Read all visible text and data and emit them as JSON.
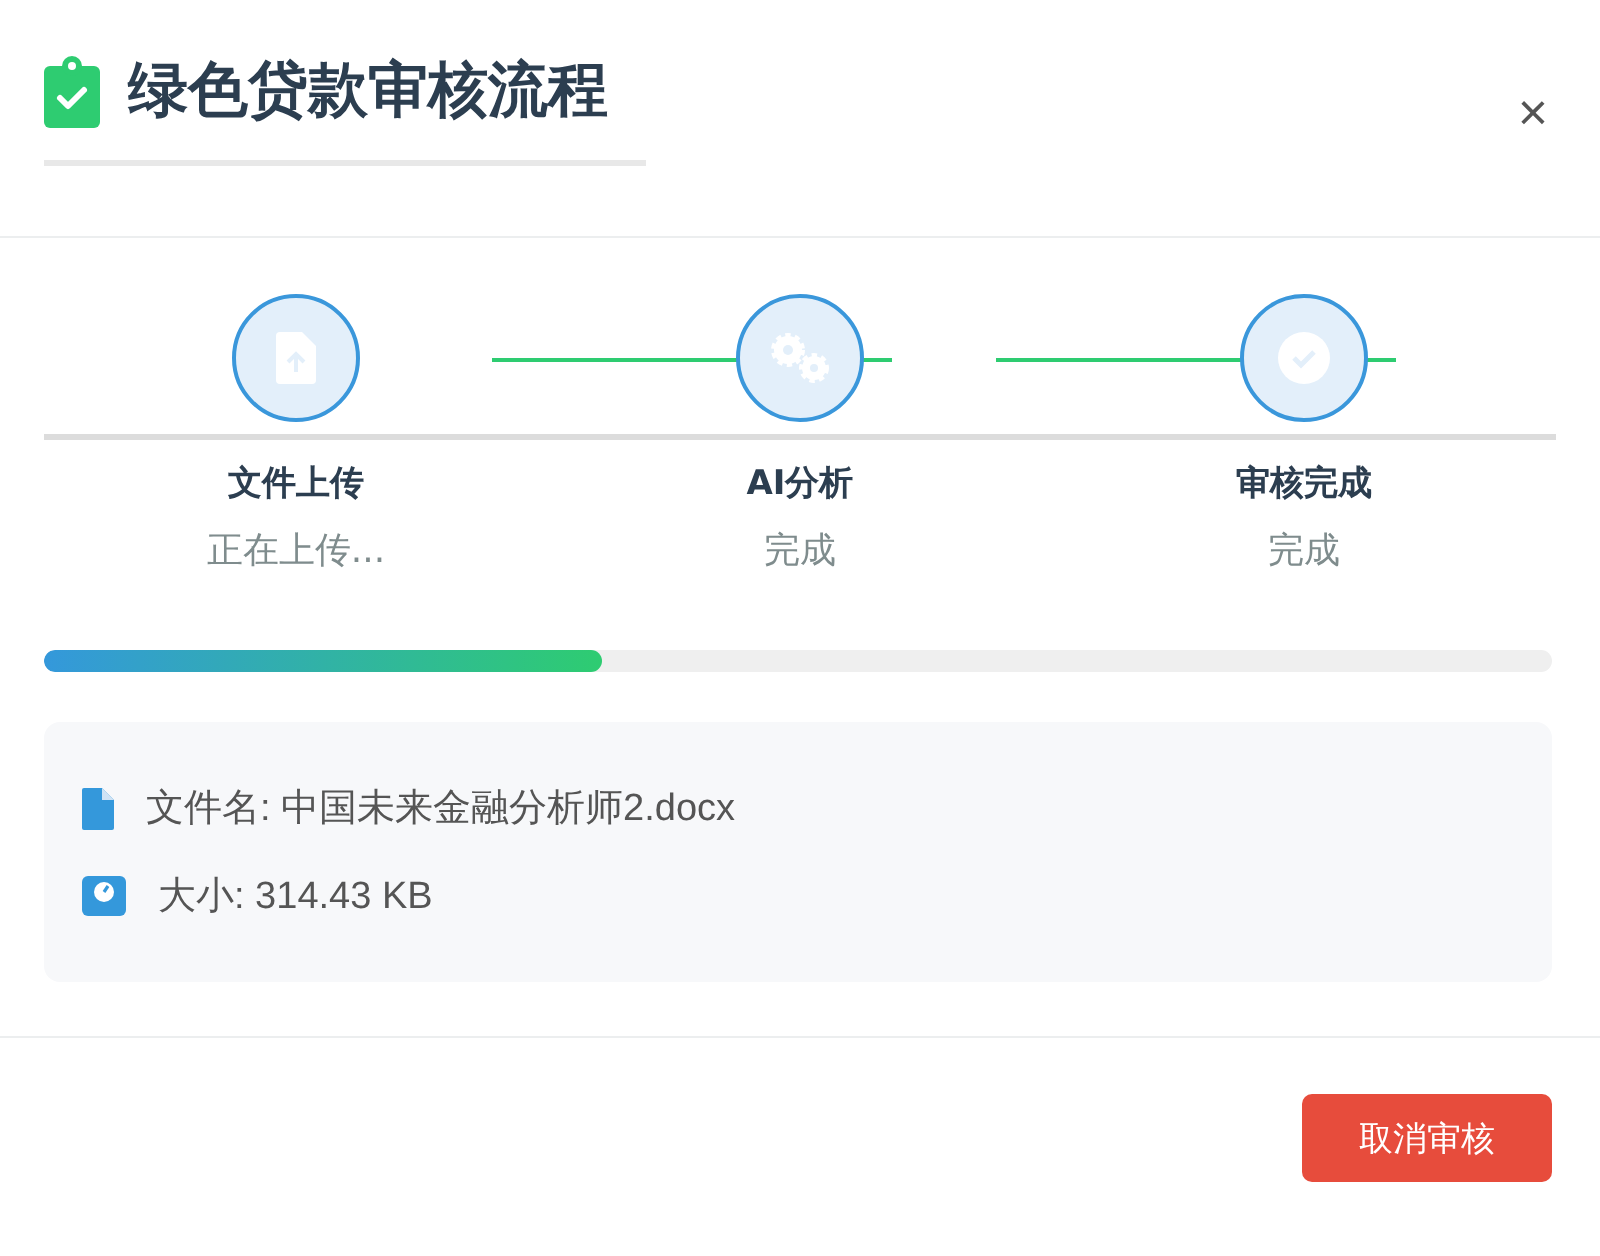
{
  "dialog": {
    "title": "绿色贷款审核流程",
    "close": "×"
  },
  "steps": [
    {
      "kind": "upload",
      "label": "文件上传",
      "status": "正在上传..."
    },
    {
      "kind": "gears",
      "label": "AI分析",
      "status": "完成"
    },
    {
      "kind": "check",
      "label": "审核完成",
      "status": "完成"
    }
  ],
  "progress": {
    "level": 0.37
  },
  "file_info": [
    {
      "kind": "file",
      "text": "文件名: 中国未来金融分析师2.docx"
    },
    {
      "kind": "size",
      "text": "大小: 314.43 KB"
    }
  ],
  "buttons": [
    {
      "label": "取消审核"
    }
  ]
}
